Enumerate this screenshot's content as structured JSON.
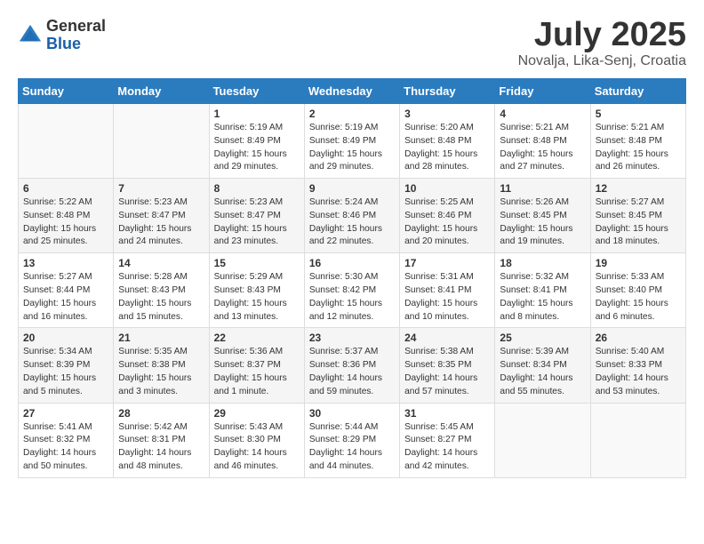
{
  "header": {
    "logo": {
      "general": "General",
      "blue": "Blue"
    },
    "title": "July 2025",
    "location": "Novalja, Lika-Senj, Croatia"
  },
  "calendar": {
    "days_of_week": [
      "Sunday",
      "Monday",
      "Tuesday",
      "Wednesday",
      "Thursday",
      "Friday",
      "Saturday"
    ],
    "weeks": [
      [
        {
          "day": "",
          "info": ""
        },
        {
          "day": "",
          "info": ""
        },
        {
          "day": "1",
          "info": "Sunrise: 5:19 AM\nSunset: 8:49 PM\nDaylight: 15 hours\nand 29 minutes."
        },
        {
          "day": "2",
          "info": "Sunrise: 5:19 AM\nSunset: 8:49 PM\nDaylight: 15 hours\nand 29 minutes."
        },
        {
          "day": "3",
          "info": "Sunrise: 5:20 AM\nSunset: 8:48 PM\nDaylight: 15 hours\nand 28 minutes."
        },
        {
          "day": "4",
          "info": "Sunrise: 5:21 AM\nSunset: 8:48 PM\nDaylight: 15 hours\nand 27 minutes."
        },
        {
          "day": "5",
          "info": "Sunrise: 5:21 AM\nSunset: 8:48 PM\nDaylight: 15 hours\nand 26 minutes."
        }
      ],
      [
        {
          "day": "6",
          "info": "Sunrise: 5:22 AM\nSunset: 8:48 PM\nDaylight: 15 hours\nand 25 minutes."
        },
        {
          "day": "7",
          "info": "Sunrise: 5:23 AM\nSunset: 8:47 PM\nDaylight: 15 hours\nand 24 minutes."
        },
        {
          "day": "8",
          "info": "Sunrise: 5:23 AM\nSunset: 8:47 PM\nDaylight: 15 hours\nand 23 minutes."
        },
        {
          "day": "9",
          "info": "Sunrise: 5:24 AM\nSunset: 8:46 PM\nDaylight: 15 hours\nand 22 minutes."
        },
        {
          "day": "10",
          "info": "Sunrise: 5:25 AM\nSunset: 8:46 PM\nDaylight: 15 hours\nand 20 minutes."
        },
        {
          "day": "11",
          "info": "Sunrise: 5:26 AM\nSunset: 8:45 PM\nDaylight: 15 hours\nand 19 minutes."
        },
        {
          "day": "12",
          "info": "Sunrise: 5:27 AM\nSunset: 8:45 PM\nDaylight: 15 hours\nand 18 minutes."
        }
      ],
      [
        {
          "day": "13",
          "info": "Sunrise: 5:27 AM\nSunset: 8:44 PM\nDaylight: 15 hours\nand 16 minutes."
        },
        {
          "day": "14",
          "info": "Sunrise: 5:28 AM\nSunset: 8:43 PM\nDaylight: 15 hours\nand 15 minutes."
        },
        {
          "day": "15",
          "info": "Sunrise: 5:29 AM\nSunset: 8:43 PM\nDaylight: 15 hours\nand 13 minutes."
        },
        {
          "day": "16",
          "info": "Sunrise: 5:30 AM\nSunset: 8:42 PM\nDaylight: 15 hours\nand 12 minutes."
        },
        {
          "day": "17",
          "info": "Sunrise: 5:31 AM\nSunset: 8:41 PM\nDaylight: 15 hours\nand 10 minutes."
        },
        {
          "day": "18",
          "info": "Sunrise: 5:32 AM\nSunset: 8:41 PM\nDaylight: 15 hours\nand 8 minutes."
        },
        {
          "day": "19",
          "info": "Sunrise: 5:33 AM\nSunset: 8:40 PM\nDaylight: 15 hours\nand 6 minutes."
        }
      ],
      [
        {
          "day": "20",
          "info": "Sunrise: 5:34 AM\nSunset: 8:39 PM\nDaylight: 15 hours\nand 5 minutes."
        },
        {
          "day": "21",
          "info": "Sunrise: 5:35 AM\nSunset: 8:38 PM\nDaylight: 15 hours\nand 3 minutes."
        },
        {
          "day": "22",
          "info": "Sunrise: 5:36 AM\nSunset: 8:37 PM\nDaylight: 15 hours\nand 1 minute."
        },
        {
          "day": "23",
          "info": "Sunrise: 5:37 AM\nSunset: 8:36 PM\nDaylight: 14 hours\nand 59 minutes."
        },
        {
          "day": "24",
          "info": "Sunrise: 5:38 AM\nSunset: 8:35 PM\nDaylight: 14 hours\nand 57 minutes."
        },
        {
          "day": "25",
          "info": "Sunrise: 5:39 AM\nSunset: 8:34 PM\nDaylight: 14 hours\nand 55 minutes."
        },
        {
          "day": "26",
          "info": "Sunrise: 5:40 AM\nSunset: 8:33 PM\nDaylight: 14 hours\nand 53 minutes."
        }
      ],
      [
        {
          "day": "27",
          "info": "Sunrise: 5:41 AM\nSunset: 8:32 PM\nDaylight: 14 hours\nand 50 minutes."
        },
        {
          "day": "28",
          "info": "Sunrise: 5:42 AM\nSunset: 8:31 PM\nDaylight: 14 hours\nand 48 minutes."
        },
        {
          "day": "29",
          "info": "Sunrise: 5:43 AM\nSunset: 8:30 PM\nDaylight: 14 hours\nand 46 minutes."
        },
        {
          "day": "30",
          "info": "Sunrise: 5:44 AM\nSunset: 8:29 PM\nDaylight: 14 hours\nand 44 minutes."
        },
        {
          "day": "31",
          "info": "Sunrise: 5:45 AM\nSunset: 8:27 PM\nDaylight: 14 hours\nand 42 minutes."
        },
        {
          "day": "",
          "info": ""
        },
        {
          "day": "",
          "info": ""
        }
      ]
    ]
  }
}
